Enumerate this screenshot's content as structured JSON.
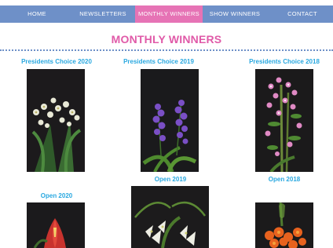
{
  "nav": {
    "items": [
      {
        "label": "HOME",
        "active": false
      },
      {
        "label": "NEWSLETTERS",
        "active": false
      },
      {
        "label": "MONTHLY WINNERS",
        "active": true
      },
      {
        "label": "SHOW WINNERS",
        "active": false
      },
      {
        "label": "CONTACT",
        "active": false
      }
    ]
  },
  "page": {
    "title": "MONTHLY WINNERS"
  },
  "winners": [
    {
      "caption": "Presidents Choice 2020",
      "image": "orchid-white-spray"
    },
    {
      "caption": "Presidents Choice 2019",
      "image": "orchid-purple"
    },
    {
      "caption": "Presidents Choice 2018",
      "image": "orchid-pink-dendrobium"
    },
    {
      "caption": "Open 2020",
      "image": "orchid-red"
    },
    {
      "caption": "Open 2019",
      "image": "orchid-white-pendant"
    },
    {
      "caption": "Open 2018",
      "image": "orchid-orange"
    }
  ],
  "colors": {
    "nav_bg": "#6e90c8",
    "nav_active_bg": "#e673b5",
    "title": "#e05aa8",
    "caption": "#29a8e0",
    "photo_bg": "#1c1a1c"
  }
}
